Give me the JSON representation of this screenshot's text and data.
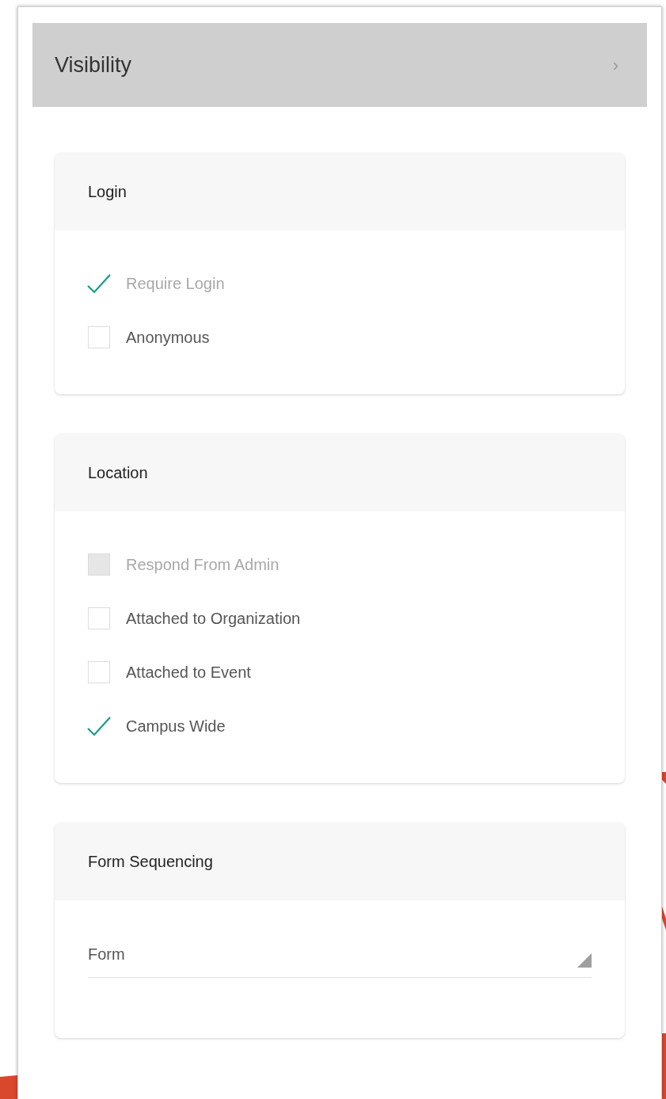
{
  "panel": {
    "title": "Visibility",
    "chevron": "›"
  },
  "sections": [
    {
      "kind": "checklist",
      "title": "Login",
      "items": [
        {
          "label": "Require Login",
          "checked": true,
          "disabled": true
        },
        {
          "label": "Anonymous",
          "checked": false,
          "disabled": false
        }
      ]
    },
    {
      "kind": "checklist",
      "title": "Location",
      "items": [
        {
          "label": "Respond From Admin",
          "checked": false,
          "disabled": true
        },
        {
          "label": "Attached to Organization",
          "checked": false,
          "disabled": false
        },
        {
          "label": "Attached to Event",
          "checked": false,
          "disabled": false
        },
        {
          "label": "Campus Wide",
          "checked": true,
          "disabled": false
        }
      ]
    },
    {
      "kind": "select",
      "title": "Form Sequencing",
      "field": {
        "placeholder": "Form"
      }
    }
  ]
}
